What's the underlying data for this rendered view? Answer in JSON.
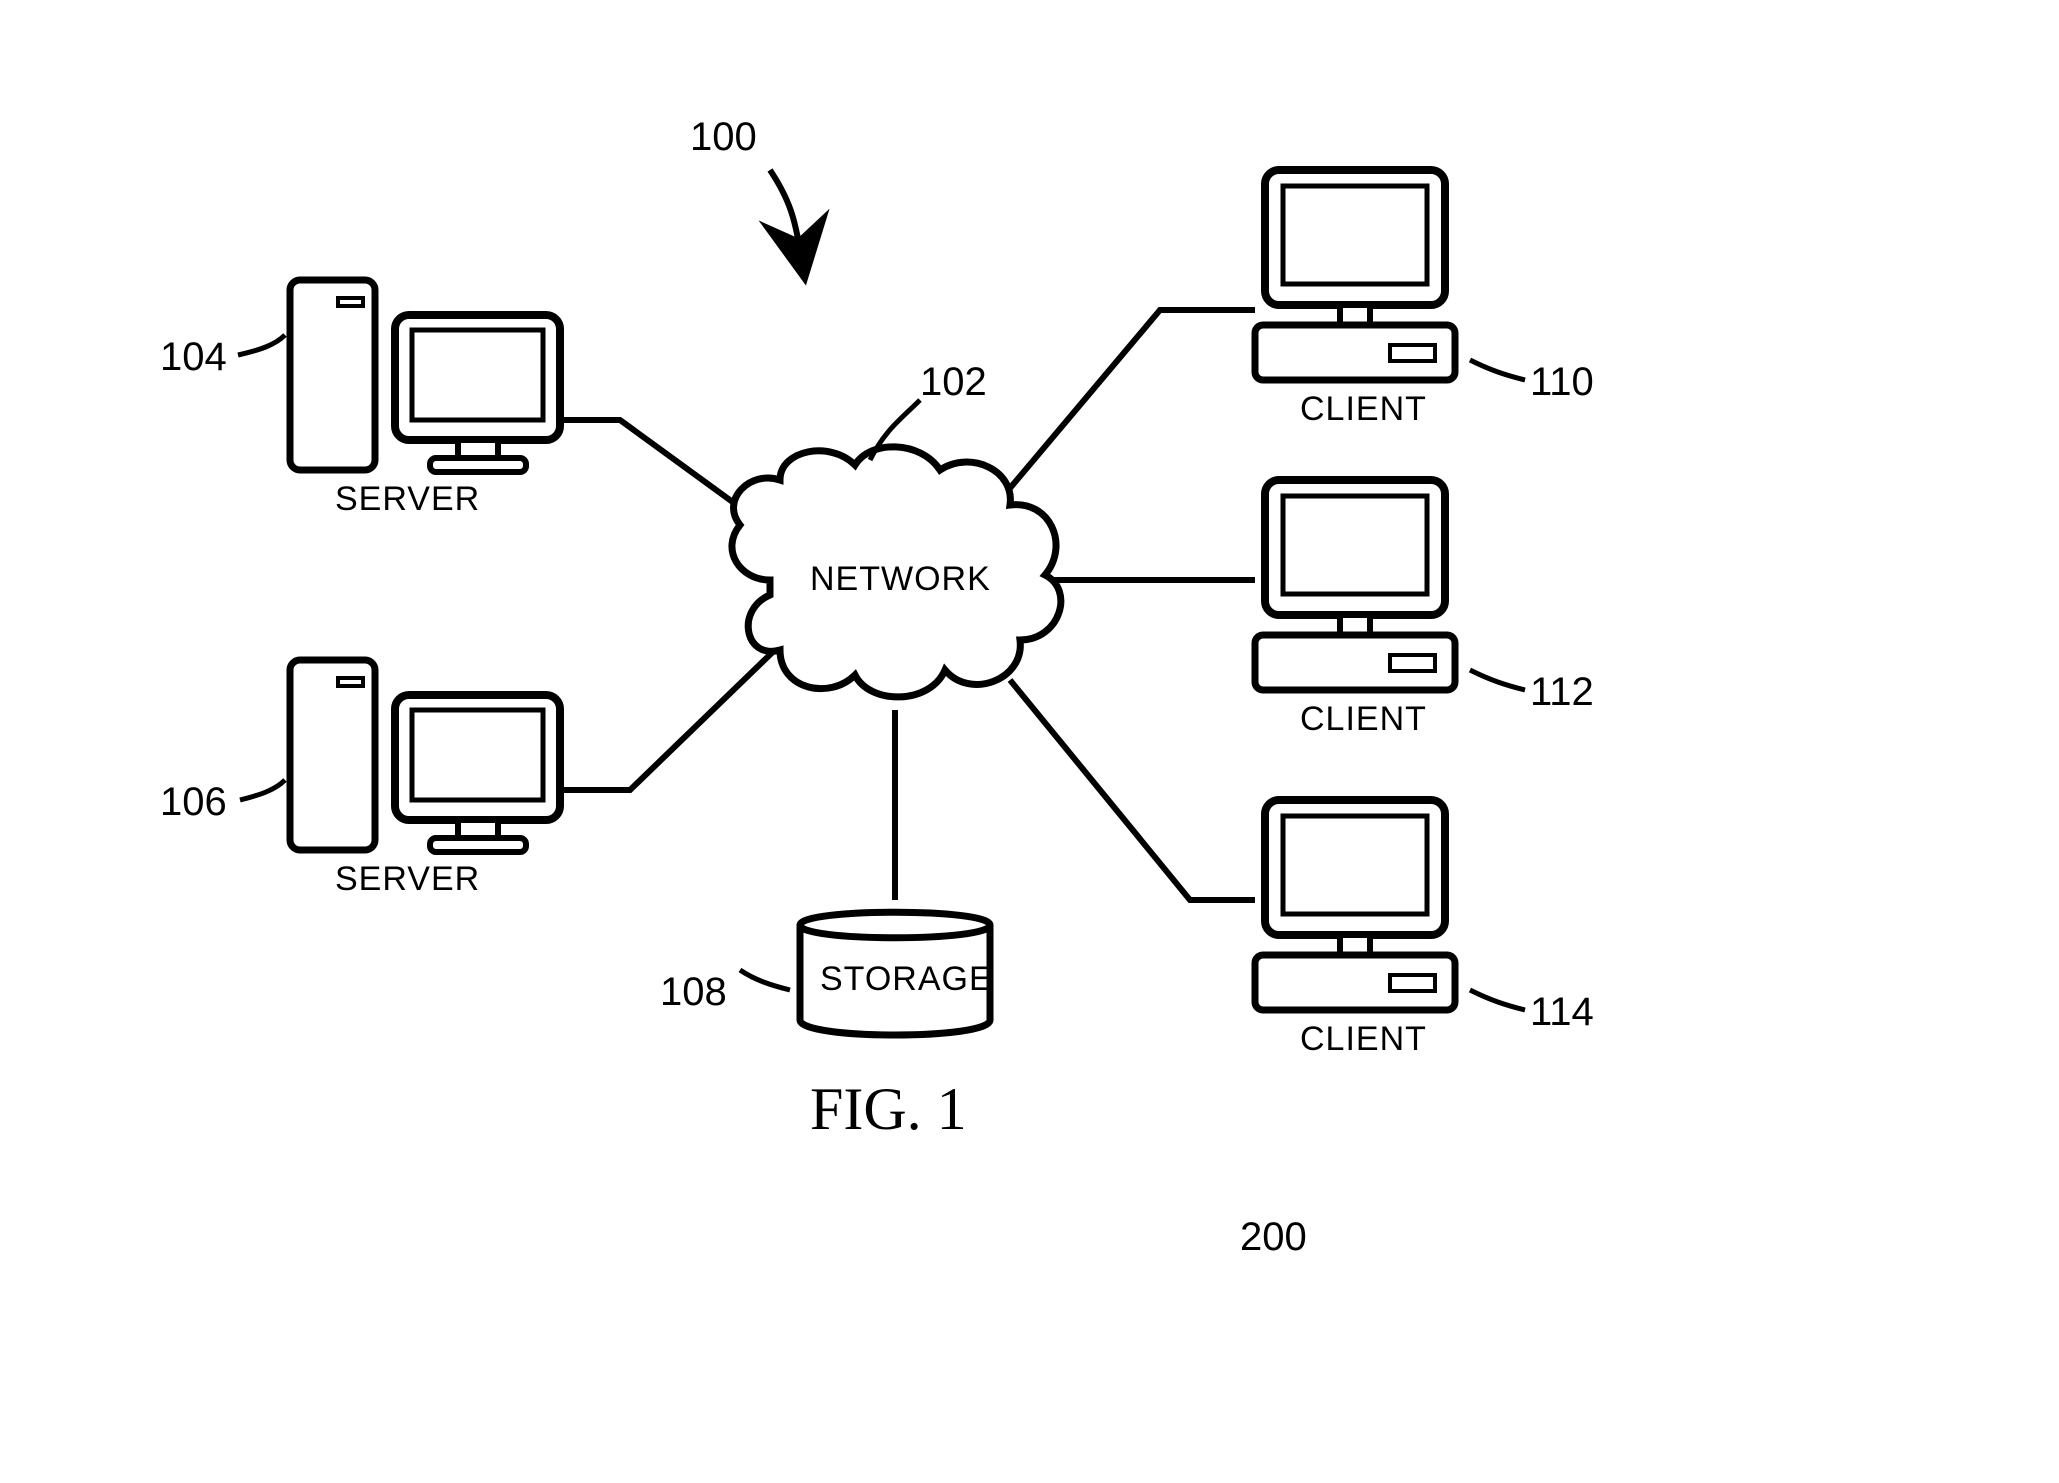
{
  "figure": {
    "caption": "FIG. 1",
    "system_ref": "100",
    "extra_ref": "200"
  },
  "network": {
    "ref": "102",
    "label": "NETWORK"
  },
  "storage": {
    "ref": "108",
    "label": "STORAGE"
  },
  "servers": [
    {
      "ref": "104",
      "label": "SERVER"
    },
    {
      "ref": "106",
      "label": "SERVER"
    }
  ],
  "clients": [
    {
      "ref": "110",
      "label": "CLIENT"
    },
    {
      "ref": "112",
      "label": "CLIENT"
    },
    {
      "ref": "114",
      "label": "CLIENT"
    }
  ]
}
